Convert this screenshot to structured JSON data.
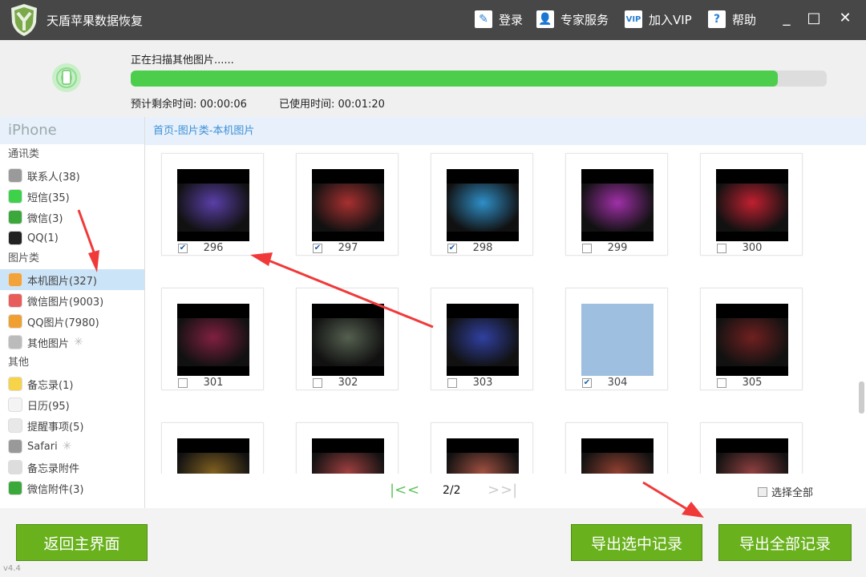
{
  "app": {
    "title": "天盾苹果数据恢复",
    "version": "v4.4"
  },
  "toolbar": [
    {
      "label": "登录",
      "icon": "pencil-icon"
    },
    {
      "label": "专家服务",
      "icon": "person-icon"
    },
    {
      "label": "加入VIP",
      "icon": "vip-icon"
    },
    {
      "label": "帮助",
      "icon": "help-icon"
    }
  ],
  "scan": {
    "label": "正在扫描其他图片......",
    "progress_percent": 93,
    "remaining": "预计剩余时间: 00:00:06",
    "elapsed": "已使用时间: 00:01:20"
  },
  "sidebar": {
    "device": "iPhone",
    "groups": [
      {
        "label": "通讯类",
        "items": [
          {
            "label": "联系人(38)",
            "color": "#9a9a9a"
          },
          {
            "label": "短信(35)",
            "color": "#3ed14a"
          },
          {
            "label": "微信(3)",
            "color": "#3aa83a"
          },
          {
            "label": "QQ(1)",
            "color": "#222"
          }
        ]
      },
      {
        "label": "图片类",
        "items": [
          {
            "label": "本机图片(327)",
            "color": "#f2a33a",
            "selected": true
          },
          {
            "label": "微信图片(9003)",
            "color": "#e85c5c"
          },
          {
            "label": "QQ图片(7980)",
            "color": "#f0a030"
          },
          {
            "label": "其他图片",
            "color": "#bbb",
            "loading": true
          }
        ]
      },
      {
        "label": "其他",
        "items": [
          {
            "label": "备忘录(1)",
            "color": "#f7d34a"
          },
          {
            "label": "日历(95)",
            "color": "#f4f4f4"
          },
          {
            "label": "提醒事项(5)",
            "color": "#e8e8e8"
          },
          {
            "label": "Safari",
            "color": "#999",
            "loading": true
          },
          {
            "label": "备忘录附件",
            "color": "#ddd"
          },
          {
            "label": "微信附件(3)",
            "color": "#3aa83a"
          }
        ]
      }
    ]
  },
  "breadcrumb": "首页-图片类-本机图片",
  "photos": [
    {
      "n": "296",
      "checked": true,
      "c": "#5a3fa8"
    },
    {
      "n": "297",
      "checked": true,
      "c": "#a83030"
    },
    {
      "n": "298",
      "checked": true,
      "c": "#2f8fc8"
    },
    {
      "n": "299",
      "checked": false,
      "c": "#a030a8"
    },
    {
      "n": "300",
      "checked": false,
      "c": "#c02030"
    },
    {
      "n": "301",
      "checked": false,
      "c": "#802040"
    },
    {
      "n": "302",
      "checked": false,
      "c": "#556050"
    },
    {
      "n": "303",
      "checked": false,
      "c": "#3040a0"
    },
    {
      "n": "304",
      "checked": true,
      "c": "#9fbfe0"
    },
    {
      "n": "305",
      "checked": false,
      "c": "#702020"
    },
    {
      "n": "",
      "checked": false,
      "c": "#806020"
    },
    {
      "n": "",
      "checked": false,
      "c": "#a04040"
    },
    {
      "n": "",
      "checked": false,
      "c": "#a05040"
    },
    {
      "n": "",
      "checked": false,
      "c": "#904030"
    },
    {
      "n": "",
      "checked": false,
      "c": "#904040"
    }
  ],
  "pager": {
    "page": "2/2",
    "select_all": "选择全部"
  },
  "buttons": {
    "back": "返回主界面",
    "export_selected": "导出选中记录",
    "export_all": "导出全部记录"
  }
}
